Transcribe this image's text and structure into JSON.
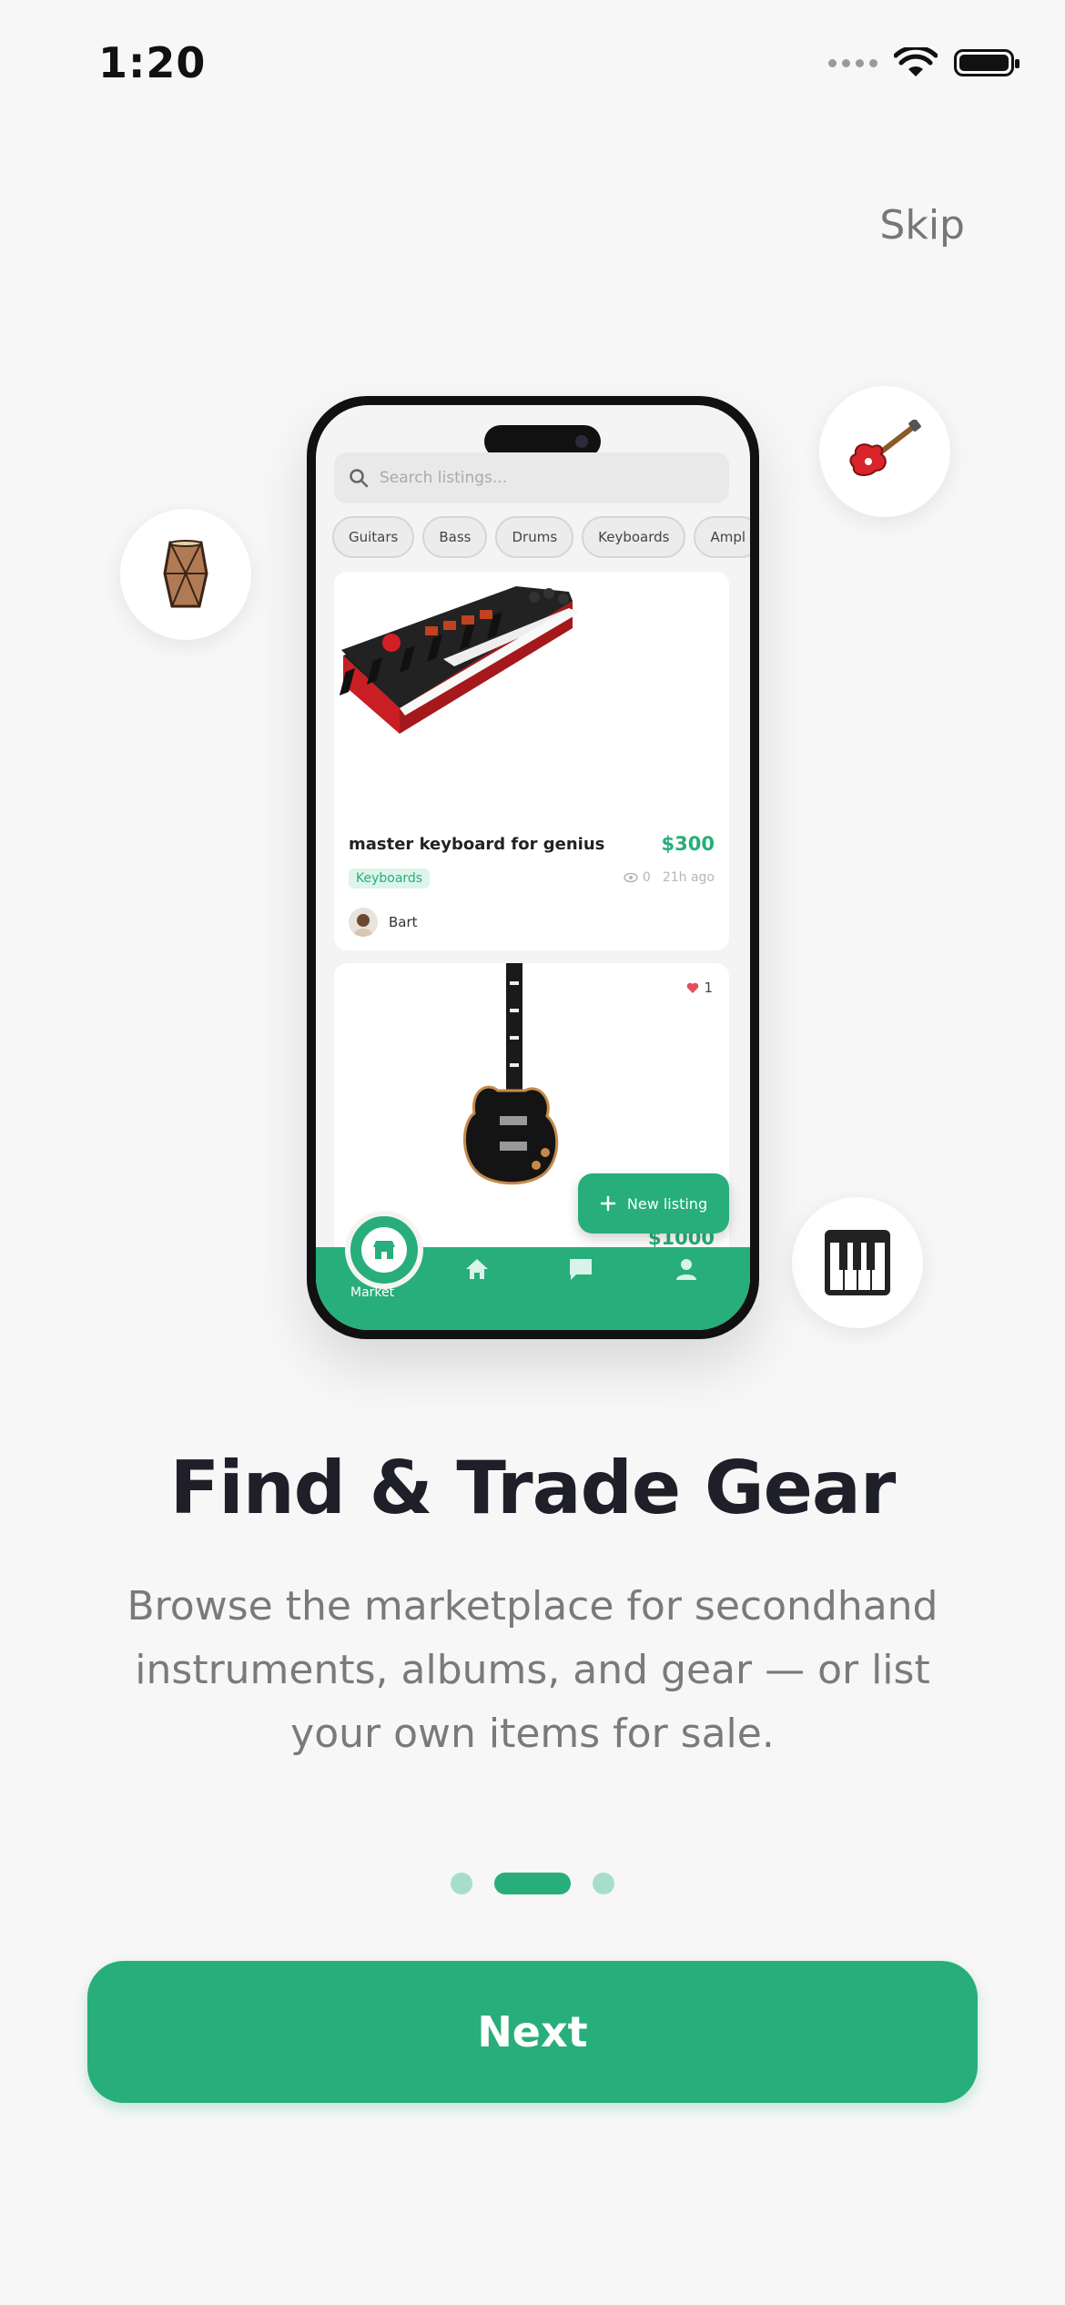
{
  "status_bar": {
    "time": "1:20"
  },
  "skip_label": "Skip",
  "mock_screen": {
    "search_placeholder": "Search listings...",
    "chips": [
      "Guitars",
      "Bass",
      "Drums",
      "Keyboards",
      "Ampl"
    ],
    "listing1": {
      "title": "master keyboard for genius",
      "price": "$300",
      "tag": "Keyboards",
      "views": "0",
      "time": "21h ago",
      "user": "Bart"
    },
    "listing2": {
      "likes": "1",
      "price": "$1000"
    },
    "new_listing_label": "New listing",
    "tab_market_label": "Market"
  },
  "headline": "Find & Trade Gear",
  "subtitle": "Browse the marketplace for secondhand instruments, albums, and gear — or list your own items for sale.",
  "pagination": {
    "total": 3,
    "active": 2
  },
  "next_label": "Next",
  "colors": {
    "accent": "#27ae7a",
    "dot_inactive": "#a7decb",
    "background": "#f7f7f7"
  }
}
